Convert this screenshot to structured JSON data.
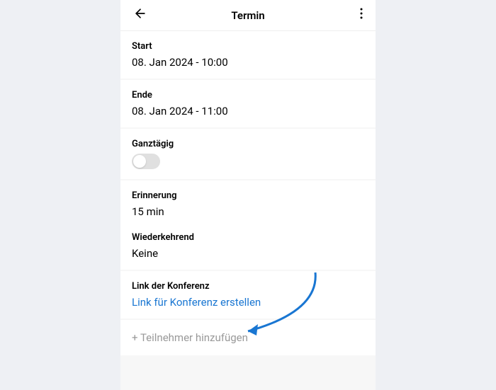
{
  "header": {
    "title": "Termin"
  },
  "start": {
    "label": "Start",
    "value": "08. Jan 2024 - 10:00"
  },
  "end": {
    "label": "Ende",
    "value": "08. Jan 2024 - 11:00"
  },
  "allDay": {
    "label": "Ganztägig",
    "enabled": false
  },
  "reminder": {
    "label": "Erinnerung",
    "value": "15 min"
  },
  "recurring": {
    "label": "Wiederkehrend",
    "value": "Keine"
  },
  "conference": {
    "label": "Link der Konferenz",
    "action": "Link für Konferenz erstellen"
  },
  "participants": {
    "addLabel": "+ Teilnehmer hinzufügen"
  },
  "colors": {
    "link": "#1976d2",
    "arrow": "#1976d2"
  }
}
